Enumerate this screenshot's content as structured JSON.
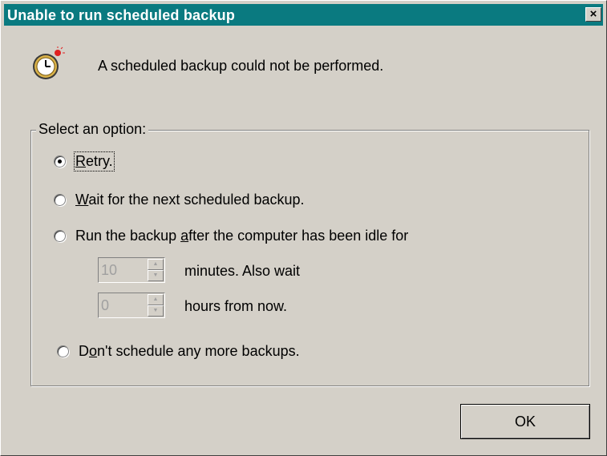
{
  "window": {
    "title": "Unable to run scheduled backup",
    "close_glyph": "×"
  },
  "message": "A scheduled backup could not be performed.",
  "icon": "alarm-clock-icon",
  "options": {
    "legend": "Select an option:",
    "retry": {
      "pre": "",
      "key": "R",
      "post": "etry.",
      "selected": true
    },
    "wait": {
      "pre": "",
      "key": "W",
      "post": "ait for the next scheduled backup.",
      "selected": false
    },
    "idle": {
      "pre": "Run the backup ",
      "key": "a",
      "post": "fter the computer has been idle for",
      "selected": false
    },
    "minutes": {
      "value": "10",
      "label": "minutes.  Also wait"
    },
    "hours": {
      "value": "0",
      "label": "hours from now."
    },
    "noschedule": {
      "pre": "D",
      "key": "o",
      "post": "n't schedule any more backups.",
      "selected": false
    }
  },
  "buttons": {
    "ok": "OK"
  },
  "colors": {
    "titlebar": "#0a7a80",
    "face": "#d4d0c8"
  }
}
